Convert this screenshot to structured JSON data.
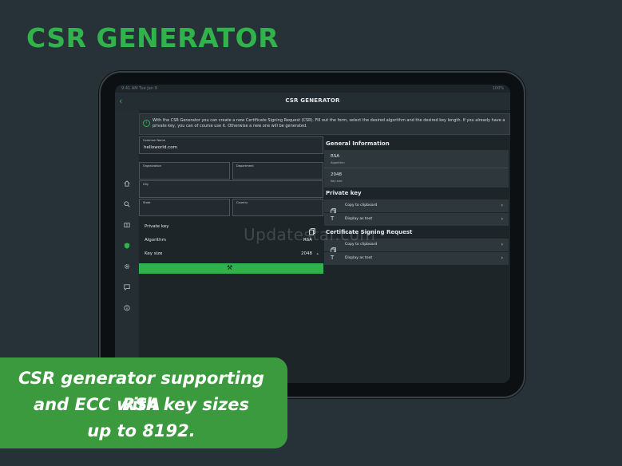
{
  "headline": "CSR GENERATOR",
  "watermark": "Updatestar.com",
  "status_bar": {
    "left": "9:41 AM  Tue Jan 9",
    "right": "100%"
  },
  "app": {
    "title": "CSR GENERATOR",
    "info_text": "With the CSR Generator you can create a new Certificate Signing Request (CSR). Fill out the form, select the desired algorithm and the desired key length. If you already have a private key, you can of course use it. Otherwise a new one will be generated.",
    "sidebar_icons": [
      "home-icon",
      "search-icon",
      "book-icon",
      "shield-icon",
      "gear-icon",
      "feedback-icon",
      "info-icon"
    ],
    "form": {
      "common_name": {
        "label": "Common Name",
        "value": "helloworld.com"
      },
      "organization": {
        "label": "Organization",
        "value": ""
      },
      "department": {
        "label": "Department",
        "value": ""
      },
      "city": {
        "label": "City",
        "value": ""
      },
      "state": {
        "label": "State",
        "value": ""
      },
      "country": {
        "label": "Country",
        "value": ""
      }
    },
    "rows": {
      "private_key": {
        "label": "Private key"
      },
      "algorithm": {
        "label": "Algorithm",
        "value": "RSA"
      },
      "key_size": {
        "label": "Key size",
        "value": "2048"
      }
    },
    "general_info": {
      "title": "General Information",
      "algorithm_value": "RSA",
      "algorithm_label": "Algorithm",
      "key_size_value": "2048",
      "key_size_label": "Key size"
    },
    "private_key_section": {
      "title": "Private key",
      "copy": "Copy to clipboard",
      "display": "Display as text"
    },
    "csr_section": {
      "title": "Certificate Signing Request",
      "copy": "Copy to clipboard",
      "display": "Display as text"
    }
  },
  "banner": {
    "line1": "CSR generator supporting RSA",
    "line2": "and ECC with key sizes",
    "line3": "up to 8192."
  },
  "colors": {
    "accent": "#2fb34a",
    "background": "#263238",
    "banner": "#3a9a3d"
  }
}
